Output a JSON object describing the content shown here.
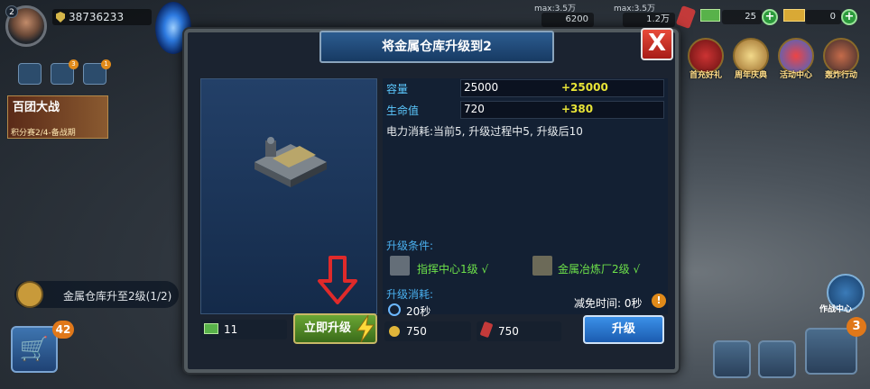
{
  "hud": {
    "level": "2",
    "power": "38736233",
    "res1_top": "max:3.5万",
    "res1_val": "6200",
    "res2_top": "max:3.5万",
    "res2_val": "1.2万",
    "cash": "25",
    "gold": "0",
    "side_badges": [
      "3",
      "1"
    ],
    "event_title": "百团大战",
    "event_sub": "积分赛2/4-备战期",
    "task_text": "金属仓库升至2级(1/2)",
    "shop_badge": "42",
    "ops_badge": "3",
    "right_icons": [
      "首充好礼",
      "周年庆典",
      "活动中心",
      "轰炸行动"
    ],
    "radar_label": "作战中心"
  },
  "dialog": {
    "title": "将金属仓库升级到2",
    "close": "X",
    "stats": [
      {
        "label": "容量",
        "value": "25000",
        "delta": "+25000"
      },
      {
        "label": "生命值",
        "value": "720",
        "delta": "+380"
      }
    ],
    "power_info": "电力消耗:当前5, 升级过程中5, 升级后10",
    "conditions_label": "升级条件:",
    "conditions": [
      "指挥中心1级 √",
      "金属冶炼厂2级 √"
    ],
    "cost_label": "升级消耗:",
    "time": "20秒",
    "metal_cost": "750",
    "oil_cost": "750",
    "reduce_time": "减免时间: 0秒",
    "cash_cost": "11",
    "instant_button": "立即升级",
    "upgrade_button": "升级"
  },
  "colors": {
    "accent_blue": "#5cc9ff",
    "accent_green": "#6ee24a",
    "accent_yellow": "#e8e437"
  }
}
